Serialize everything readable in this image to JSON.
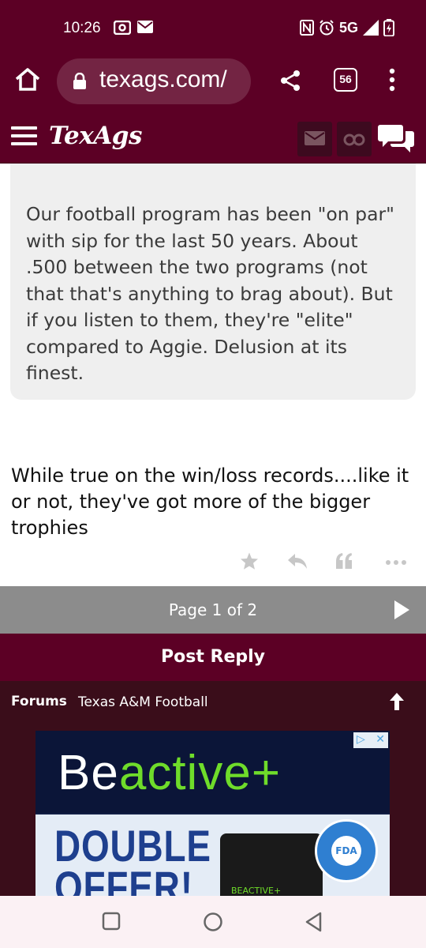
{
  "status_bar": {
    "time": "10:26",
    "network": "5G"
  },
  "browser": {
    "url": "texags.com/",
    "tab_count": "56"
  },
  "site": {
    "logo": "TexAgs"
  },
  "quote": {
    "text": "Our football program has been \"on par\" with sip for the last 50 years. About .500 between the two programs (not that that's anything to brag about). But if you listen to them, they're \"elite\" compared to Aggie. Delusion at its finest."
  },
  "reply": {
    "text": "While true on the win/loss records....like it or not, they've got more of the bigger trophies"
  },
  "pagination": {
    "label": "Page 1 of 2"
  },
  "post_reply": {
    "label": "Post Reply"
  },
  "breadcrumb": {
    "forums": "Forums",
    "current": "Texas A&M Football"
  },
  "ad": {
    "brand_white": "Be",
    "brand_green": "active",
    "brand_plus": "+",
    "headline": "DOUBLE OFFER!",
    "product_label": "BEACTIVE+",
    "badge": "FDA"
  },
  "colors": {
    "brand_maroon": "#5c0025",
    "dark_maroon": "#3a0d1a",
    "pagination_gray": "#8c8c8c",
    "quote_bg": "#efefef"
  }
}
